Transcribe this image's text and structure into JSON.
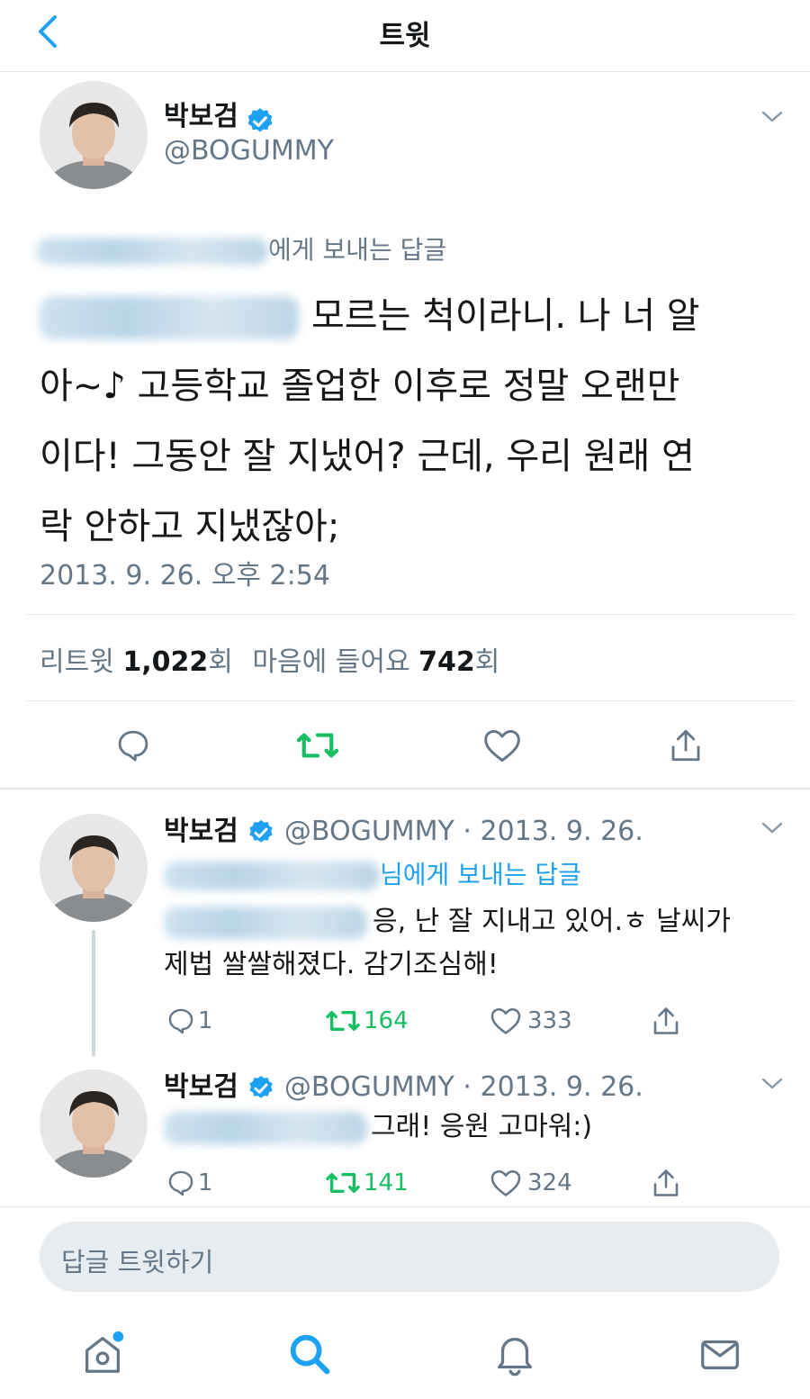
{
  "header": {
    "title": "트윗",
    "back_icon": "chevron-left-icon"
  },
  "tweet": {
    "author_name": "박보검",
    "author_handle": "@BOGUMMY",
    "reply_to_suffix": "에게 보내는 답글",
    "text_line1_after_blur": "모르는 척이라니. 나 너 알",
    "text_line2": "아~♪ 고등학교 졸업한 이후로 정말 오랜만",
    "text_line3": "이다! 그동안 잘 지냈어? 근데, 우리 원래 연",
    "text_line4": "락 안하고 지냈잖아;",
    "timestamp": "2013. 9. 26. 오후 2:54",
    "retweet_label": "리트윗",
    "retweet_count": "1,022",
    "retweet_unit": "회",
    "like_label": "마음에 들어요",
    "like_count": "742",
    "like_unit": "회"
  },
  "replies": [
    {
      "author_name": "박보검",
      "author_handle": "@BOGUMMY",
      "date": "· 2013. 9. 26.",
      "reply_to_suffix": "님에게 보내는 답글",
      "text_line1_after_blur": "응, 난 잘 지내고 있어.ㅎ 날씨가",
      "text_line2": "제법 쌀쌀해졌다. 감기조심해!",
      "reply_count": "1",
      "retweet_count": "164",
      "like_count": "333"
    },
    {
      "author_name": "박보검",
      "author_handle": "@BOGUMMY",
      "date": "· 2013. 9. 26.",
      "text_line1_after_blur": "그래! 응원 고마워:)",
      "reply_count": "1",
      "retweet_count": "141",
      "like_count": "324"
    }
  ],
  "compose": {
    "placeholder": "답글 트윗하기"
  },
  "colors": {
    "accent": "#1da1f2",
    "retweet_green": "#17bf63",
    "secondary_text": "#657786",
    "divider": "#e1e8ed"
  },
  "tabs": [
    "home-icon",
    "search-icon",
    "notifications-icon",
    "messages-icon"
  ]
}
